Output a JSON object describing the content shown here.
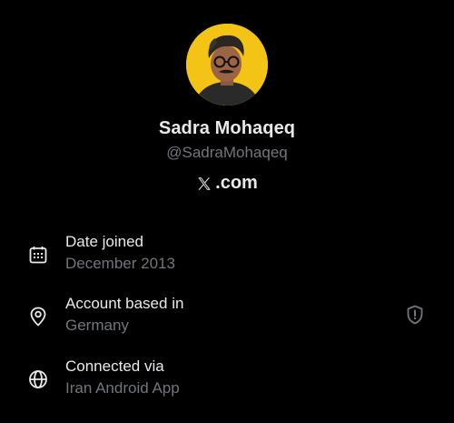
{
  "profile": {
    "display_name": "Sadra Mohaqeq",
    "handle": "@SadraMohaqeq",
    "site": ".com",
    "avatar_bg": "#f3c316"
  },
  "details": {
    "date_joined": {
      "label": "Date joined",
      "value": "December 2013",
      "icon": "calendar-icon"
    },
    "account_based_in": {
      "label": "Account based in",
      "value": "Germany",
      "icon": "location-pin-icon",
      "badge_icon": "shield-alert-icon"
    },
    "connected_via": {
      "label": "Connected via",
      "value": "Iran Android App",
      "icon": "globe-icon"
    }
  },
  "colors": {
    "background": "#000000",
    "primary_text": "#e7e9ea",
    "secondary_text": "#71767b"
  }
}
